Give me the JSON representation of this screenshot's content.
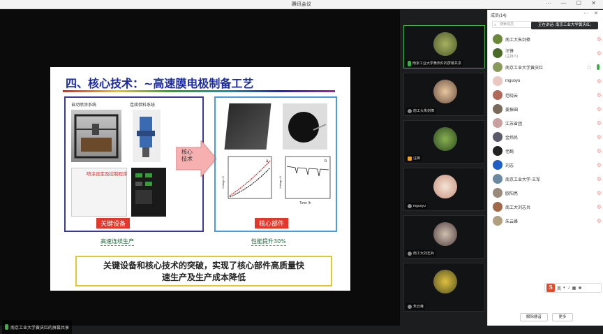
{
  "window": {
    "title": "腾讯会议",
    "controls": "⋯ — ☐ ✕"
  },
  "share": {
    "label": "南京工业大学黄庆红的屏幕共享"
  },
  "slide": {
    "title": "四、核心技术：~高速膜电极制备工艺",
    "left_box": {
      "img1_caption": "自动喷涂系统",
      "img2_caption": "连续供料系统",
      "img3_caption": "喷涂设定及控制程序",
      "red_label": "关键设备",
      "green_caption": "高速连续生产"
    },
    "arrow_text": [
      "核心",
      "技术"
    ],
    "right_box": {
      "chart1_label": "a",
      "chart2_label": "b",
      "chart2_xlabel": "Time /h",
      "chart1_ylabel": "Voltage /V",
      "chart2_ylabel": "Voltage /V",
      "red_label": "核心部件",
      "green_caption": "性能提升30%"
    },
    "summary": [
      "关键设备和核心技术的突破，实现了核心部件高质量快",
      "速生产及生产成本降低"
    ]
  },
  "thumbnails": [
    {
      "name": "南京工业大学黄庆红的屏幕共享",
      "active": true,
      "mic": "on"
    },
    {
      "name": "南工大朱剑樟",
      "active": false,
      "mic": "off"
    },
    {
      "name": "汪锋",
      "active": false,
      "mic": "off"
    },
    {
      "name": "mguoyu",
      "active": false,
      "mic": "off"
    },
    {
      "name": "南工大刘志兵",
      "active": false,
      "mic": "off"
    },
    {
      "name": "朱云峰",
      "active": false,
      "mic": "off"
    }
  ],
  "panel": {
    "header": "成员(14)",
    "header_ctrls": "⋯ ✕",
    "search_placeholder": "搜索成员",
    "speaking": "正在讲话: 南京工业大学黄庆红;",
    "members": [
      {
        "name": "南工大朱剑樟",
        "sub": "",
        "mic": "off"
      },
      {
        "name": "汪锋",
        "sub": "(主持人)",
        "mic": "off"
      },
      {
        "name": "南京工业大学黄庆红",
        "sub": "",
        "mic": "on"
      },
      {
        "name": "mguoyu",
        "sub": "",
        "mic": "off"
      },
      {
        "name": "范晓云",
        "sub": "",
        "mic": "off"
      },
      {
        "name": "姜振田",
        "sub": "",
        "mic": "off"
      },
      {
        "name": "江苏省团",
        "sub": "",
        "mic": "off"
      },
      {
        "name": "金炜民",
        "sub": "",
        "mic": "off"
      },
      {
        "name": "老鹤",
        "sub": "",
        "mic": "off"
      },
      {
        "name": "刘志",
        "sub": "",
        "mic": "off"
      },
      {
        "name": "南京工业大学-王军",
        "sub": "",
        "mic": "off"
      },
      {
        "name": "欧阳亮",
        "sub": "",
        "mic": "off"
      },
      {
        "name": "南工大刘志兵",
        "sub": "",
        "mic": "off"
      },
      {
        "name": "朱云峰",
        "sub": "",
        "mic": "off"
      }
    ],
    "unmute_all": "解除静音",
    "more": "更多",
    "ime_text": "英"
  },
  "colors": {
    "accent_green": "#3fae49",
    "mute_red": "#e34a4a",
    "slide_title": "#1a2aa6",
    "label_red": "#e3372a"
  }
}
